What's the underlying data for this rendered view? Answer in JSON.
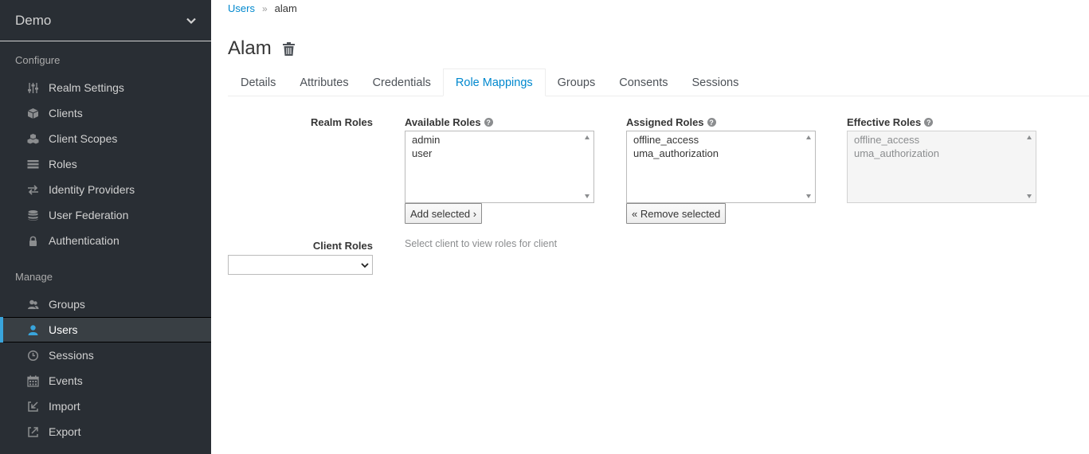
{
  "realm": {
    "name": "Demo"
  },
  "sidebar": {
    "configure_title": "Configure",
    "configure_items": [
      {
        "label": "Realm Settings",
        "icon": "sliders-icon"
      },
      {
        "label": "Clients",
        "icon": "cube-icon"
      },
      {
        "label": "Client Scopes",
        "icon": "cubes-icon"
      },
      {
        "label": "Roles",
        "icon": "list-icon"
      },
      {
        "label": "Identity Providers",
        "icon": "exchange-icon"
      },
      {
        "label": "User Federation",
        "icon": "database-icon"
      },
      {
        "label": "Authentication",
        "icon": "lock-icon"
      }
    ],
    "manage_title": "Manage",
    "manage_items": [
      {
        "label": "Groups",
        "icon": "users-icon"
      },
      {
        "label": "Users",
        "icon": "user-icon",
        "active": true
      },
      {
        "label": "Sessions",
        "icon": "clock-icon"
      },
      {
        "label": "Events",
        "icon": "calendar-icon"
      },
      {
        "label": "Import",
        "icon": "import-icon"
      },
      {
        "label": "Export",
        "icon": "export-icon"
      }
    ]
  },
  "breadcrumb": {
    "parent": "Users",
    "separator": "»",
    "current": "alam"
  },
  "page": {
    "title": "Alam"
  },
  "tabs": [
    {
      "label": "Details"
    },
    {
      "label": "Attributes"
    },
    {
      "label": "Credentials"
    },
    {
      "label": "Role Mappings",
      "active": true
    },
    {
      "label": "Groups"
    },
    {
      "label": "Consents"
    },
    {
      "label": "Sessions"
    }
  ],
  "role_mappings": {
    "realm_roles_label": "Realm Roles",
    "available": {
      "label": "Available Roles",
      "items": [
        "admin",
        "user"
      ]
    },
    "assigned": {
      "label": "Assigned Roles",
      "items": [
        "offline_access",
        "uma_authorization"
      ]
    },
    "effective": {
      "label": "Effective Roles",
      "items": [
        "offline_access",
        "uma_authorization"
      ]
    },
    "add_button": "Add selected ›",
    "remove_button": "« Remove selected",
    "client_roles_label": "Client Roles",
    "client_hint": "Select client to view roles for client",
    "client_select_value": ""
  },
  "colors": {
    "sidebar_bg": "#292e34",
    "accent": "#0088ce",
    "active_marker": "#39a5dc"
  }
}
